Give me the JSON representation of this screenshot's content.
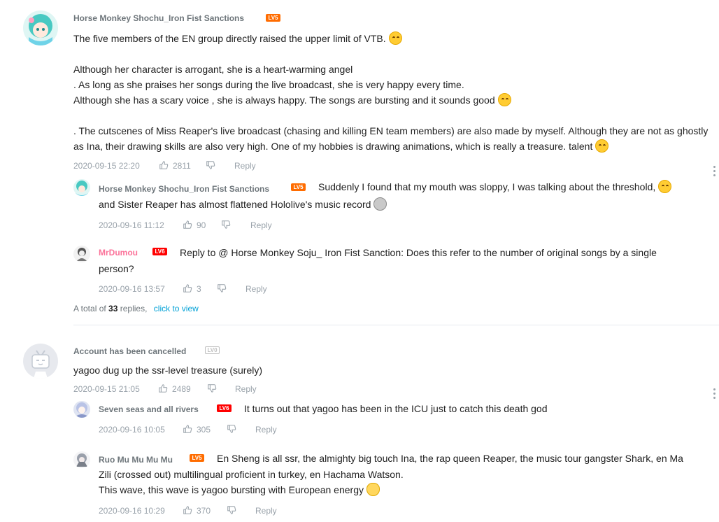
{
  "threads": [
    {
      "user": "Horse Monkey Shochu_Iron Fist Sanctions",
      "level": "LV5",
      "paragraphs": [
        "The five members of the EN group directly raised the upper limit of VTB.",
        "Although her character is arrogant, she is a heart-warming angel",
        ". As long as she praises her songs during the live broadcast, she is very happy every time.",
        "Although she has a scary voice , she is always happy. The songs are bursting and it sounds good",
        ". The cutscenes of Miss Reaper's live broadcast (chasing and killing EN team members) are also made by myself. Although they are not as ghostly as Ina, their drawing skills are also very high. One of my hobbies is drawing animations, which is really a treasure. talent"
      ],
      "time": "2020-09-15 22:20",
      "likes": "2811",
      "reply_label": "Reply",
      "replies": [
        {
          "user": "Horse Monkey Shochu_Iron Fist Sanctions",
          "level": "LV5",
          "text_1": "Suddenly I found that my mouth was sloppy, I was talking about the threshold,",
          "text_2": "and Sister Reaper has almost flattened Hololive's music record",
          "time": "2020-09-16 11:12",
          "likes": "90",
          "reply_label": "Reply"
        },
        {
          "user": "MrDumou",
          "level": "LV6",
          "text_1": "Reply to @ Horse Monkey Soju_ Iron Fist Sanction: Does this refer to the number of original songs by a single",
          "text_2": "person?",
          "time": "2020-09-16 13:57",
          "likes": "3",
          "reply_label": "Reply"
        }
      ],
      "total_prefix": "A total of",
      "total_count": "33",
      "total_suffix": "replies,",
      "view_label": "click to view"
    },
    {
      "user": "Account has been cancelled",
      "level": "LV0",
      "text": "yagoo dug up the ssr-level treasure (surely)",
      "time": "2020-09-15 21:05",
      "likes": "2489",
      "reply_label": "Reply",
      "replies": [
        {
          "user": "Seven seas and all rivers",
          "level": "LV6",
          "text_1": "It turns out that yagoo has been in the ICU just to catch this death god",
          "time": "2020-09-16 10:05",
          "likes": "305",
          "reply_label": "Reply"
        },
        {
          "user": "Ruo Mu Mu Mu Mu",
          "level": "LV5",
          "text_1": "En Sheng is all ssr, the almighty big touch Ina, the rap queen Reaper, the music tour gangster Shark, en Ma",
          "text_2": "Zili (crossed out) multilingual proficient in turkey, en Hachama Watson.",
          "text_3": "This wave, this wave is yagoo bursting with European energy",
          "time": "2020-09-16 10:29",
          "likes": "370",
          "reply_label": "Reply"
        }
      ]
    }
  ],
  "icons": {
    "like": "thumb-up-icon",
    "dislike": "thumb-down-icon",
    "more": "more-vertical-icon",
    "emoji": "emoji-icon"
  },
  "colors": {
    "username": "#6d757a",
    "vip_username": "#fb7299",
    "link": "#00a1d6",
    "meta": "#99a2aa",
    "level5": "#ff6c00",
    "level6": "#ff0000"
  }
}
